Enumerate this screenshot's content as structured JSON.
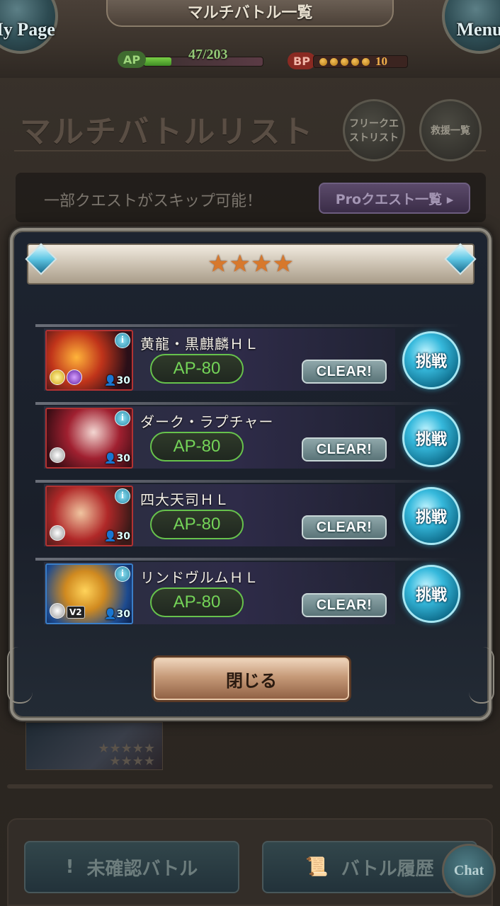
{
  "header": {
    "title": "マルチバトル一覧",
    "mypage_label": "My Page",
    "menu_label": "Menu",
    "ap_tag": "AP",
    "ap_value": "47/203",
    "ap_fraction": 0.23,
    "bp_tag": "BP",
    "bp_value": "10",
    "bp_dots": 5
  },
  "section": {
    "title": "マルチバトルリスト",
    "free_quest_label": "フリークエストリスト",
    "support_label": "救援一覧"
  },
  "skip_banner": {
    "text": "一部クエストがスキップ可能！",
    "pro_button": "Proクエスト一覧 ▸"
  },
  "modal": {
    "stars": "★★★★",
    "quests": [
      {
        "name": "黄龍・黒麒麟ＨＬ",
        "ap": "AP-80",
        "clear": "CLEAR!",
        "players": "30",
        "action": "挑戦",
        "info": "i"
      },
      {
        "name": "ダーク・ラプチャー",
        "ap": "AP-80",
        "clear": "CLEAR!",
        "players": "30",
        "action": "挑戦",
        "info": "i"
      },
      {
        "name": "四大天司ＨＬ",
        "ap": "AP-80",
        "clear": "CLEAR!",
        "players": "30",
        "action": "挑戦",
        "info": "i"
      },
      {
        "name": "リンドヴルムＨＬ",
        "ap": "AP-80",
        "clear": "CLEAR!",
        "players": "30",
        "action": "挑戦",
        "info": "i",
        "badge": "V2"
      }
    ],
    "close_label": "閉じる"
  },
  "background": {
    "thumb_stars": "★★★★★\n★★★★"
  },
  "bottom": {
    "unconfirmed_label": "未確認バトル",
    "history_label": "バトル履歴",
    "chat_label": "Chat"
  },
  "colors": {
    "ap_green": "#74d458",
    "challenge_blue": "#36b9dc",
    "star_orange": "#d7782c"
  }
}
